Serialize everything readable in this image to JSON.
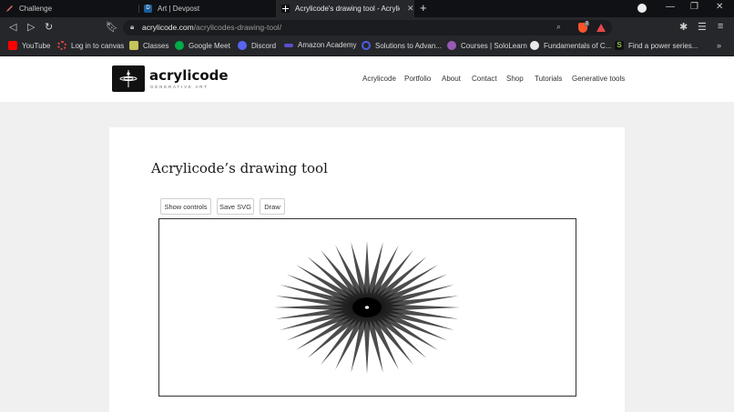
{
  "browser": {
    "tabs": [
      {
        "label": "Challenge",
        "active": false
      },
      {
        "label": "Art | Devpost",
        "active": false,
        "favicon_letter": "D"
      },
      {
        "label": "Acrylicode's drawing tool - Acrylic",
        "active": true
      }
    ],
    "url": {
      "host": "acrylicode.com",
      "path": "/acrylicodes-drawing-tool/"
    },
    "brave_badge": "2",
    "bookmarks": [
      {
        "label": "YouTube",
        "color": "#ff0000"
      },
      {
        "label": "Log in to canvas",
        "color": "#e4463c"
      },
      {
        "label": "Classes",
        "color": "#c6c35a"
      },
      {
        "label": "Google Meet",
        "color": "#00ac47"
      },
      {
        "label": "Discord",
        "color": "#5865f2"
      },
      {
        "label": "Amazon Academy",
        "color": "#5a4fcf"
      },
      {
        "label": "Solutions to Advan...",
        "color": "#4b5ee4"
      },
      {
        "label": "Courses | SoloLearn",
        "color": "#9b59b6"
      },
      {
        "label": "Fundamentals of C...",
        "color": "#e8e8e8"
      },
      {
        "label": "Find a power series...",
        "color": "#111111",
        "favicon_letter": "S"
      }
    ]
  },
  "site": {
    "logo_name": "acrylicode",
    "logo_tagline": "GENERATIVE ART",
    "menu": [
      "Acrylicode",
      "Portfolio",
      "About",
      "Contact",
      "Shop",
      "Tutorials",
      "Generative tools"
    ]
  },
  "main": {
    "title": "Acrylicode’s drawing tool",
    "buttons": {
      "show_controls": "Show controls",
      "save_svg": "Save SVG",
      "draw": "Draw"
    }
  },
  "colors": {
    "chrome_dark": "#101114",
    "chrome": "#26272b",
    "page_bg": "#f0f0f0",
    "ink": "#111111"
  }
}
